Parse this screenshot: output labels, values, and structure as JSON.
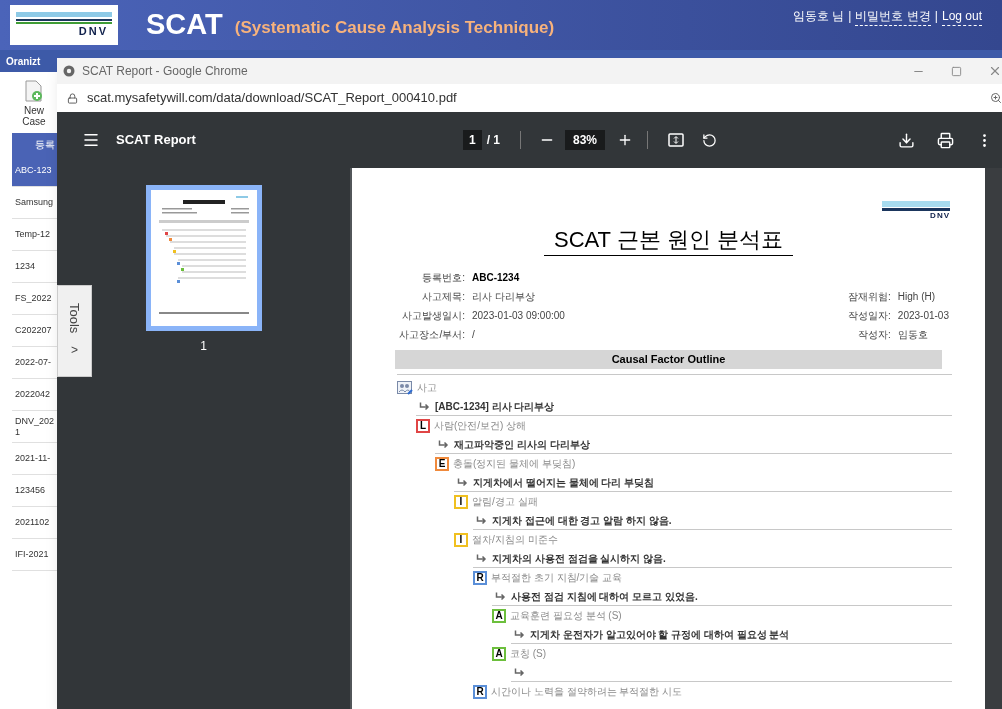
{
  "header": {
    "logo_text": "DNV",
    "app_name": "SCAT",
    "app_subtitle": "(Systematic Cause Analysis Technique)",
    "separator": "|",
    "user_links": [
      {
        "label": "임동호 님",
        "kind": "text"
      },
      {
        "label": "비밀번호 변경",
        "kind": "link"
      },
      {
        "label": "Log out",
        "kind": "link"
      }
    ]
  },
  "nav": {
    "label": "Oranizt"
  },
  "sidebar": {
    "new_button": "New Case",
    "column_header": "등록",
    "items": [
      {
        "label": "ABC-123",
        "selected": true
      },
      {
        "label": "Samsung",
        "selected": false
      },
      {
        "label": "Temp-12",
        "selected": false
      },
      {
        "label": "1234",
        "selected": false
      },
      {
        "label": "FS_2022",
        "selected": false
      },
      {
        "label": "C202207",
        "selected": false
      },
      {
        "label": "2022-07-",
        "selected": false
      },
      {
        "label": "2022042",
        "selected": false
      },
      {
        "label": "DNV_202 1",
        "selected": false
      },
      {
        "label": "2021-11-",
        "selected": false
      },
      {
        "label": "123456",
        "selected": false
      },
      {
        "label": "2021102",
        "selected": false
      },
      {
        "label": "IFI-2021",
        "selected": false
      }
    ],
    "tools_tab": {
      "label": "Tools",
      "arrow": ">"
    }
  },
  "browser": {
    "title": "SCAT Report - Google Chrome",
    "url": "scat.mysafetywill.com/data/download/SCAT_Report_000410.pdf"
  },
  "pdf_toolbar": {
    "title": "SCAT Report",
    "page": "1",
    "page_total": "/ 1",
    "zoom": "83%"
  },
  "thumbnails": [
    {
      "label": "1",
      "selected": true
    }
  ],
  "document": {
    "logo_text": "DNV",
    "title": "SCAT 근본 원인 분석표",
    "fields_left": [
      {
        "label": "등록번호:",
        "value": "ABC-1234",
        "bold": true
      },
      {
        "label": "사고제목:",
        "value": "리사 다리부상",
        "bold": false
      },
      {
        "label": "사고발생일시:",
        "value": "2023-01-03 09:00:00",
        "bold": false
      },
      {
        "label": "사고장소/부서:",
        "value": "/",
        "bold": false
      }
    ],
    "fields_right": [
      {
        "label": "잠재위험:",
        "value": "High (H)",
        "bold": false
      },
      {
        "label": "작성일자:",
        "value": "2023-01-03",
        "bold": false
      },
      {
        "label": "작성자:",
        "value": "임동호",
        "bold": false
      }
    ],
    "outline_title": "Causal Factor Outline",
    "outline": {
      "kind": "root",
      "label": "사고",
      "note": "[ABC-1234] 리사 다리부상",
      "children": [
        {
          "kind": "factor",
          "code": "L",
          "color": "#e04545",
          "label": "사람(안전/보건) 상해",
          "note": "재고파악중인 리사의 다리부상",
          "children": [
            {
              "kind": "factor",
              "code": "E",
              "color": "#f08a3c",
              "label": "충돌(정지된 물체에 부딪침)",
              "note": "지게차에서 떨어지는 물체에 다리 부딪침",
              "children": [
                {
                  "kind": "factor",
                  "code": "I",
                  "color": "#f0c020",
                  "label": "알림/경고 실패",
                  "note": "지게차 접근에 대한 경고 알람 하지 않음."
                },
                {
                  "kind": "factor",
                  "code": "I",
                  "color": "#f0c020",
                  "label": "절차/지침의 미준수",
                  "note": "지게차의 사용전 점검을 실시하지 않음.",
                  "children": [
                    {
                      "kind": "factor",
                      "code": "R",
                      "color": "#5b8fd8",
                      "label": "부적절한 초기 지침/기술 교육",
                      "note": "사용전 점검 지침에 대하여 모르고 있었음.",
                      "children": [
                        {
                          "kind": "factor",
                          "code": "A",
                          "color": "#6cbf3c",
                          "label": "교육훈련 필요성 분석 (S)",
                          "note": "지게차 운전자가 알고있어야 할 규정에 대하여 필요성 분석"
                        },
                        {
                          "kind": "factor",
                          "code": "A",
                          "color": "#6cbf3c",
                          "label": "코칭 (S)",
                          "note_blank": true
                        }
                      ]
                    },
                    {
                      "kind": "factor",
                      "code": "R",
                      "color": "#5b8fd8",
                      "label": "시간이나 노력을 절약하려는 부적절한 시도"
                    }
                  ]
                }
              ]
            }
          ]
        }
      ]
    }
  }
}
